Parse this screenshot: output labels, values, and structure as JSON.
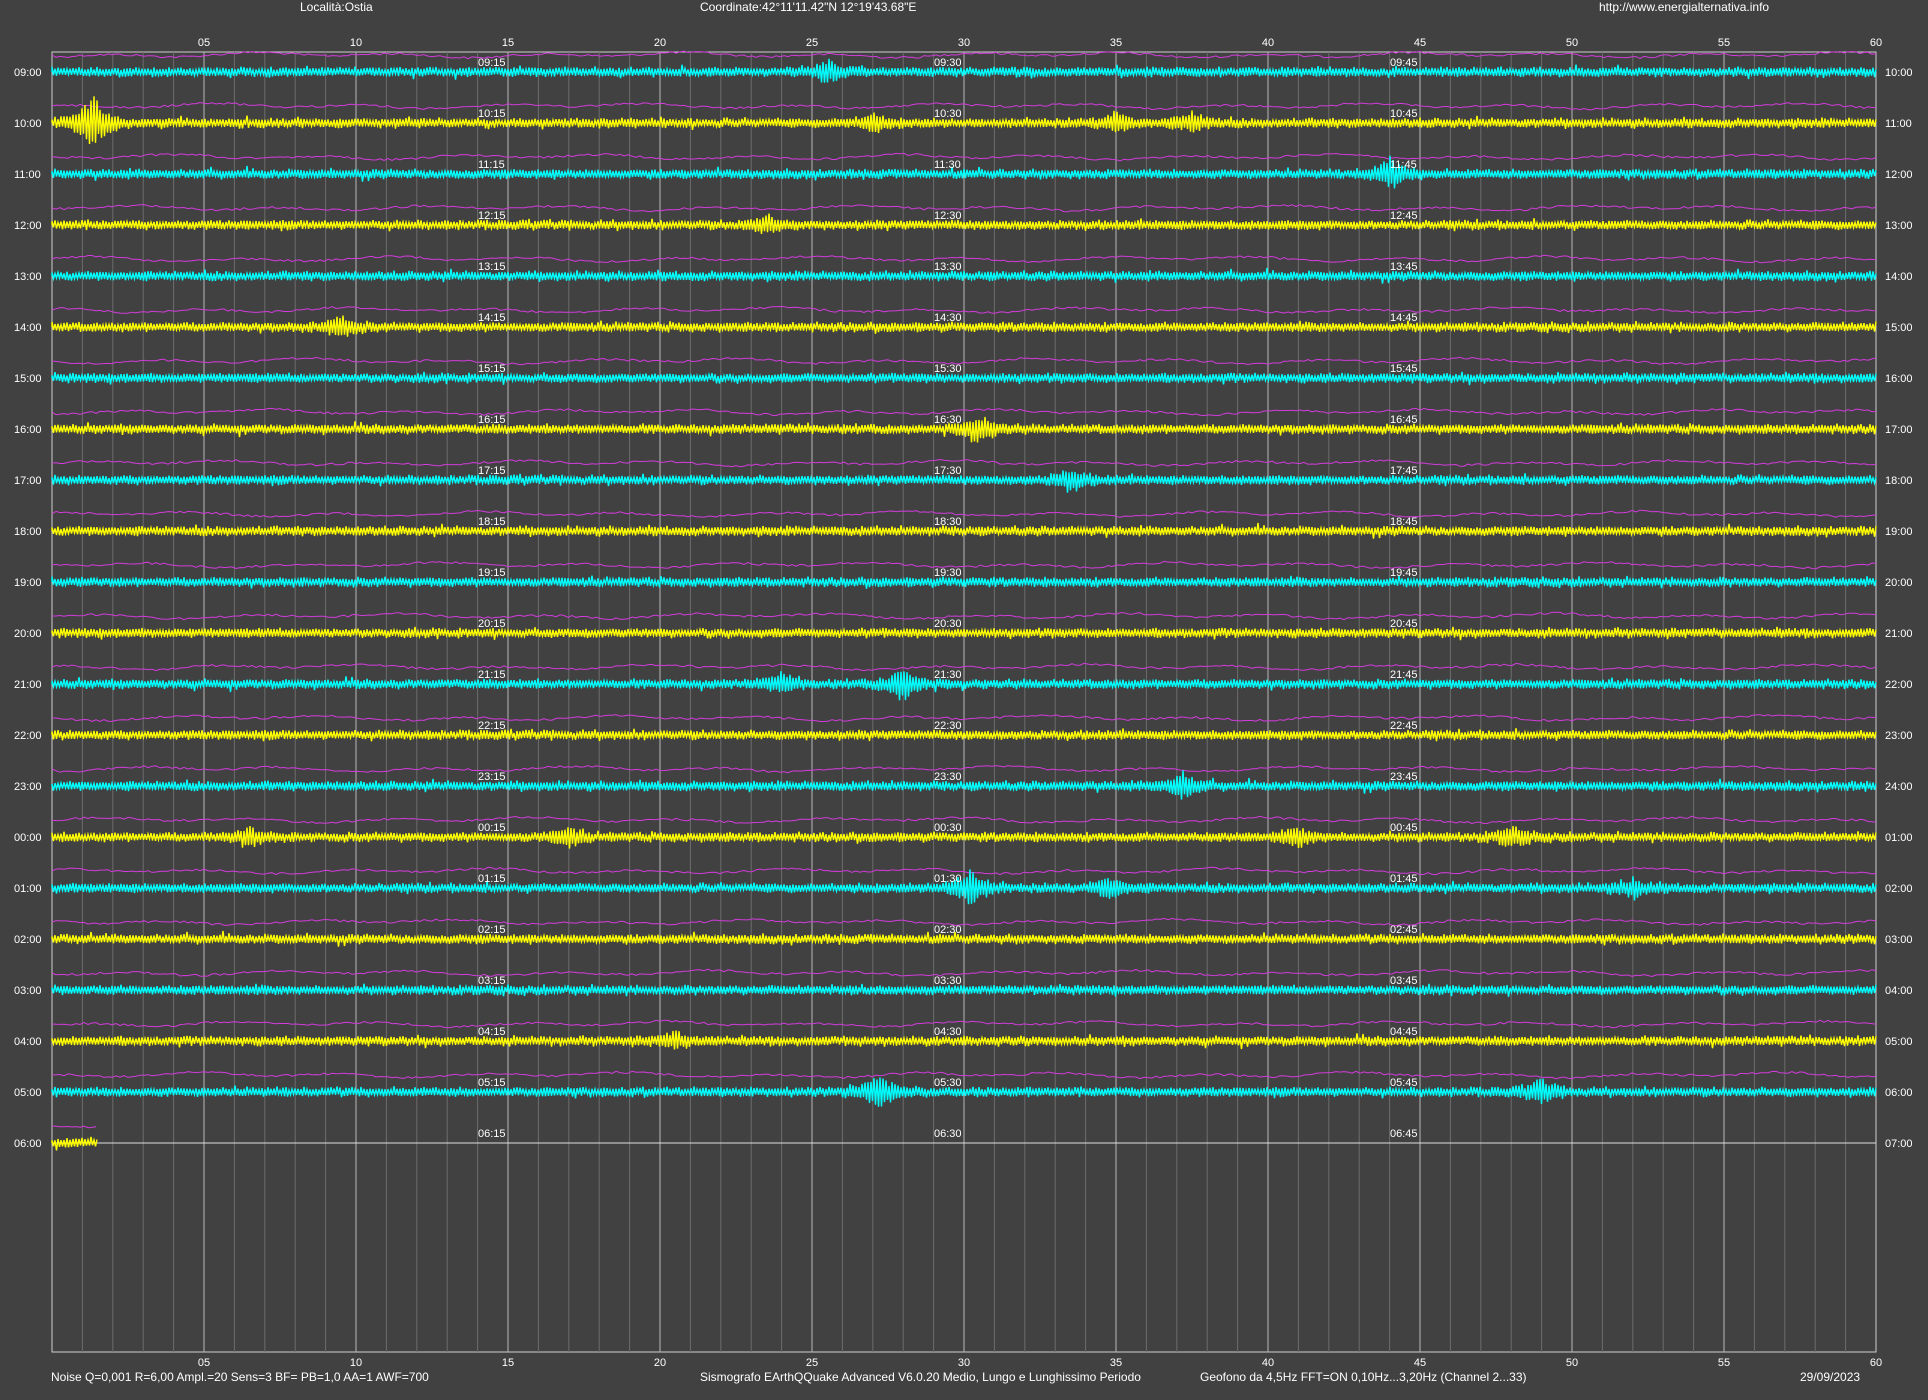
{
  "header": {
    "location": "Località:Ostia",
    "coordinates": "Coordinate:42°11'11.42\"N  12°19'43.68\"E",
    "website": "http://www.energialternativa.info"
  },
  "footer": {
    "params": "Noise Q=0,001 R=6,00 Ampl.=20 Sens=3 BF= PB=1,0 AA=1 AWF=700",
    "software": "Sismografo  EArthQQuake Advanced V6.0.20  Medio, Lungo e Lunghissimo Periodo",
    "sensor": "Geofono da 4,5Hz FFT=ON 0,10Hz...3,20Hz      (Channel 2...33)",
    "date": "29/09/2023"
  },
  "axis": {
    "minute_ticks": [
      "05",
      "10",
      "15",
      "20",
      "25",
      "30",
      "35",
      "40",
      "45",
      "50",
      "55",
      "60"
    ]
  },
  "rows": [
    {
      "left": "09:00",
      "right": "10:00",
      "marks": [
        "09:15",
        "09:30",
        "09:45"
      ]
    },
    {
      "left": "10:00",
      "right": "11:00",
      "marks": [
        "10:15",
        "10:30",
        "10:45"
      ]
    },
    {
      "left": "11:00",
      "right": "12:00",
      "marks": [
        "11:15",
        "11:30",
        "11:45"
      ]
    },
    {
      "left": "12:00",
      "right": "13:00",
      "marks": [
        "12:15",
        "12:30",
        "12:45"
      ]
    },
    {
      "left": "13:00",
      "right": "14:00",
      "marks": [
        "13:15",
        "13:30",
        "13:45"
      ]
    },
    {
      "left": "14:00",
      "right": "15:00",
      "marks": [
        "14:15",
        "14:30",
        "14:45"
      ]
    },
    {
      "left": "15:00",
      "right": "16:00",
      "marks": [
        "15:15",
        "15:30",
        "15:45"
      ]
    },
    {
      "left": "16:00",
      "right": "17:00",
      "marks": [
        "16:15",
        "16:30",
        "16:45"
      ]
    },
    {
      "left": "17:00",
      "right": "18:00",
      "marks": [
        "17:15",
        "17:30",
        "17:45"
      ]
    },
    {
      "left": "18:00",
      "right": "19:00",
      "marks": [
        "18:15",
        "18:30",
        "18:45"
      ]
    },
    {
      "left": "19:00",
      "right": "20:00",
      "marks": [
        "19:15",
        "19:30",
        "19:45"
      ]
    },
    {
      "left": "20:00",
      "right": "21:00",
      "marks": [
        "20:15",
        "20:30",
        "20:45"
      ]
    },
    {
      "left": "21:00",
      "right": "22:00",
      "marks": [
        "21:15",
        "21:30",
        "21:45"
      ]
    },
    {
      "left": "22:00",
      "right": "23:00",
      "marks": [
        "22:15",
        "22:30",
        "22:45"
      ]
    },
    {
      "left": "23:00",
      "right": "24:00",
      "marks": [
        "23:15",
        "23:30",
        "23:45"
      ]
    },
    {
      "left": "00:00",
      "right": "01:00",
      "marks": [
        "00:15",
        "00:30",
        "00:45"
      ]
    },
    {
      "left": "01:00",
      "right": "02:00",
      "marks": [
        "01:15",
        "01:30",
        "01:45"
      ]
    },
    {
      "left": "02:00",
      "right": "03:00",
      "marks": [
        "02:15",
        "02:30",
        "02:45"
      ]
    },
    {
      "left": "03:00",
      "right": "04:00",
      "marks": [
        "03:15",
        "03:30",
        "03:45"
      ]
    },
    {
      "left": "04:00",
      "right": "05:00",
      "marks": [
        "04:15",
        "04:30",
        "04:45"
      ]
    },
    {
      "left": "05:00",
      "right": "06:00",
      "marks": [
        "05:15",
        "05:30",
        "05:45"
      ]
    },
    {
      "left": "06:00",
      "right": "07:00",
      "marks": [
        "06:15",
        "06:30",
        "06:45"
      ]
    }
  ],
  "colors": {
    "background": "#414141",
    "trace_a": "#00ffff",
    "trace_b": "#ffff00",
    "long_period": "#d23cdc",
    "grid": "#9a9a9a",
    "text": "#ffffff"
  },
  "trace_profile": {
    "minutes_recorded_last_row": 1.5,
    "events": [
      {
        "row": 0,
        "minute": 25.5,
        "strength": 10
      },
      {
        "row": 1,
        "minute": 1.3,
        "strength": 28
      },
      {
        "row": 1,
        "minute": 27.0,
        "strength": 8
      },
      {
        "row": 1,
        "minute": 35.0,
        "strength": 9
      },
      {
        "row": 1,
        "minute": 37.5,
        "strength": 9
      },
      {
        "row": 2,
        "minute": 44.0,
        "strength": 14
      },
      {
        "row": 3,
        "minute": 23.5,
        "strength": 8
      },
      {
        "row": 5,
        "minute": 9.5,
        "strength": 10
      },
      {
        "row": 7,
        "minute": 30.5,
        "strength": 13
      },
      {
        "row": 8,
        "minute": 33.5,
        "strength": 11
      },
      {
        "row": 12,
        "minute": 28.0,
        "strength": 16
      },
      {
        "row": 12,
        "minute": 24.0,
        "strength": 8
      },
      {
        "row": 14,
        "minute": 37.2,
        "strength": 12
      },
      {
        "row": 15,
        "minute": 6.5,
        "strength": 8
      },
      {
        "row": 15,
        "minute": 17.0,
        "strength": 8
      },
      {
        "row": 15,
        "minute": 41.0,
        "strength": 8
      },
      {
        "row": 15,
        "minute": 48.0,
        "strength": 9
      },
      {
        "row": 16,
        "minute": 30.2,
        "strength": 20
      },
      {
        "row": 16,
        "minute": 34.8,
        "strength": 10
      },
      {
        "row": 16,
        "minute": 52.0,
        "strength": 9
      },
      {
        "row": 19,
        "minute": 20.5,
        "strength": 7
      },
      {
        "row": 20,
        "minute": 27.2,
        "strength": 16
      },
      {
        "row": 20,
        "minute": 49.0,
        "strength": 11
      }
    ]
  }
}
